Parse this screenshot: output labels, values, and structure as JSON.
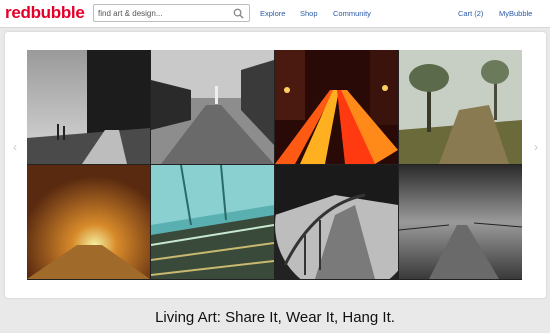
{
  "header": {
    "logo_part1": "red",
    "logo_part2": "bubble",
    "search_placeholder": "find art & design...",
    "nav": {
      "explore": "Explore",
      "shop": "Shop",
      "community": "Community",
      "cart": "Cart (2)",
      "account": "MyBubble"
    }
  },
  "hero": {
    "prev_arrow": "‹",
    "next_arrow": "›",
    "tagline": "Living Art: Share It, Wear It, Hang It."
  },
  "colors": {
    "brand": "#e4002b",
    "link": "#2a5aa8"
  }
}
